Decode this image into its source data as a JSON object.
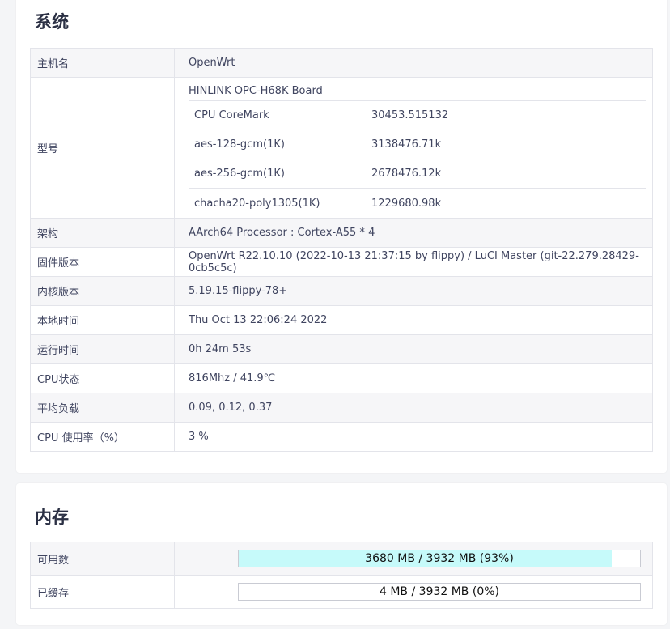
{
  "system": {
    "title": "系统",
    "hostname": {
      "label": "主机名",
      "value": "OpenWrt"
    },
    "model": {
      "label": "型号",
      "name": "HINLINK OPC-H68K Board",
      "benchmarks": [
        {
          "name": "CPU CoreMark",
          "value": "30453.515132"
        },
        {
          "name": "aes-128-gcm(1K)",
          "value": "3138476.71k"
        },
        {
          "name": "aes-256-gcm(1K)",
          "value": "2678476.12k"
        },
        {
          "name": "chacha20-poly1305(1K)",
          "value": "1229680.98k"
        }
      ]
    },
    "rows": [
      {
        "label": "架构",
        "value": "AArch64 Processor : Cortex-A55 * 4"
      },
      {
        "label": "固件版本",
        "value": "OpenWrt R22.10.10 (2022-10-13 21:37:15 by flippy) / LuCI Master (git-22.279.28429-0cb5c5c)"
      },
      {
        "label": "内核版本",
        "value": "5.19.15-flippy-78+"
      },
      {
        "label": "本地时间",
        "value": "Thu Oct 13 22:06:24 2022"
      },
      {
        "label": "运行时间",
        "value": "0h 24m 53s"
      },
      {
        "label": "CPU状态",
        "value": "816Mhz / 41.9℃"
      },
      {
        "label": "平均负载",
        "value": "0.09, 0.12, 0.37"
      },
      {
        "label": "CPU 使用率（%）",
        "value": "3 %"
      }
    ]
  },
  "memory": {
    "title": "内存",
    "rows": [
      {
        "label": "可用数",
        "text": "3680 MB / 3932 MB (93%)",
        "fraction": 0.93,
        "fill_color": "#c6fafa"
      },
      {
        "label": "已缓存",
        "text": "4 MB / 3932 MB (0%)",
        "fraction": 0.0,
        "fill_color": "#c6fafa"
      }
    ]
  }
}
